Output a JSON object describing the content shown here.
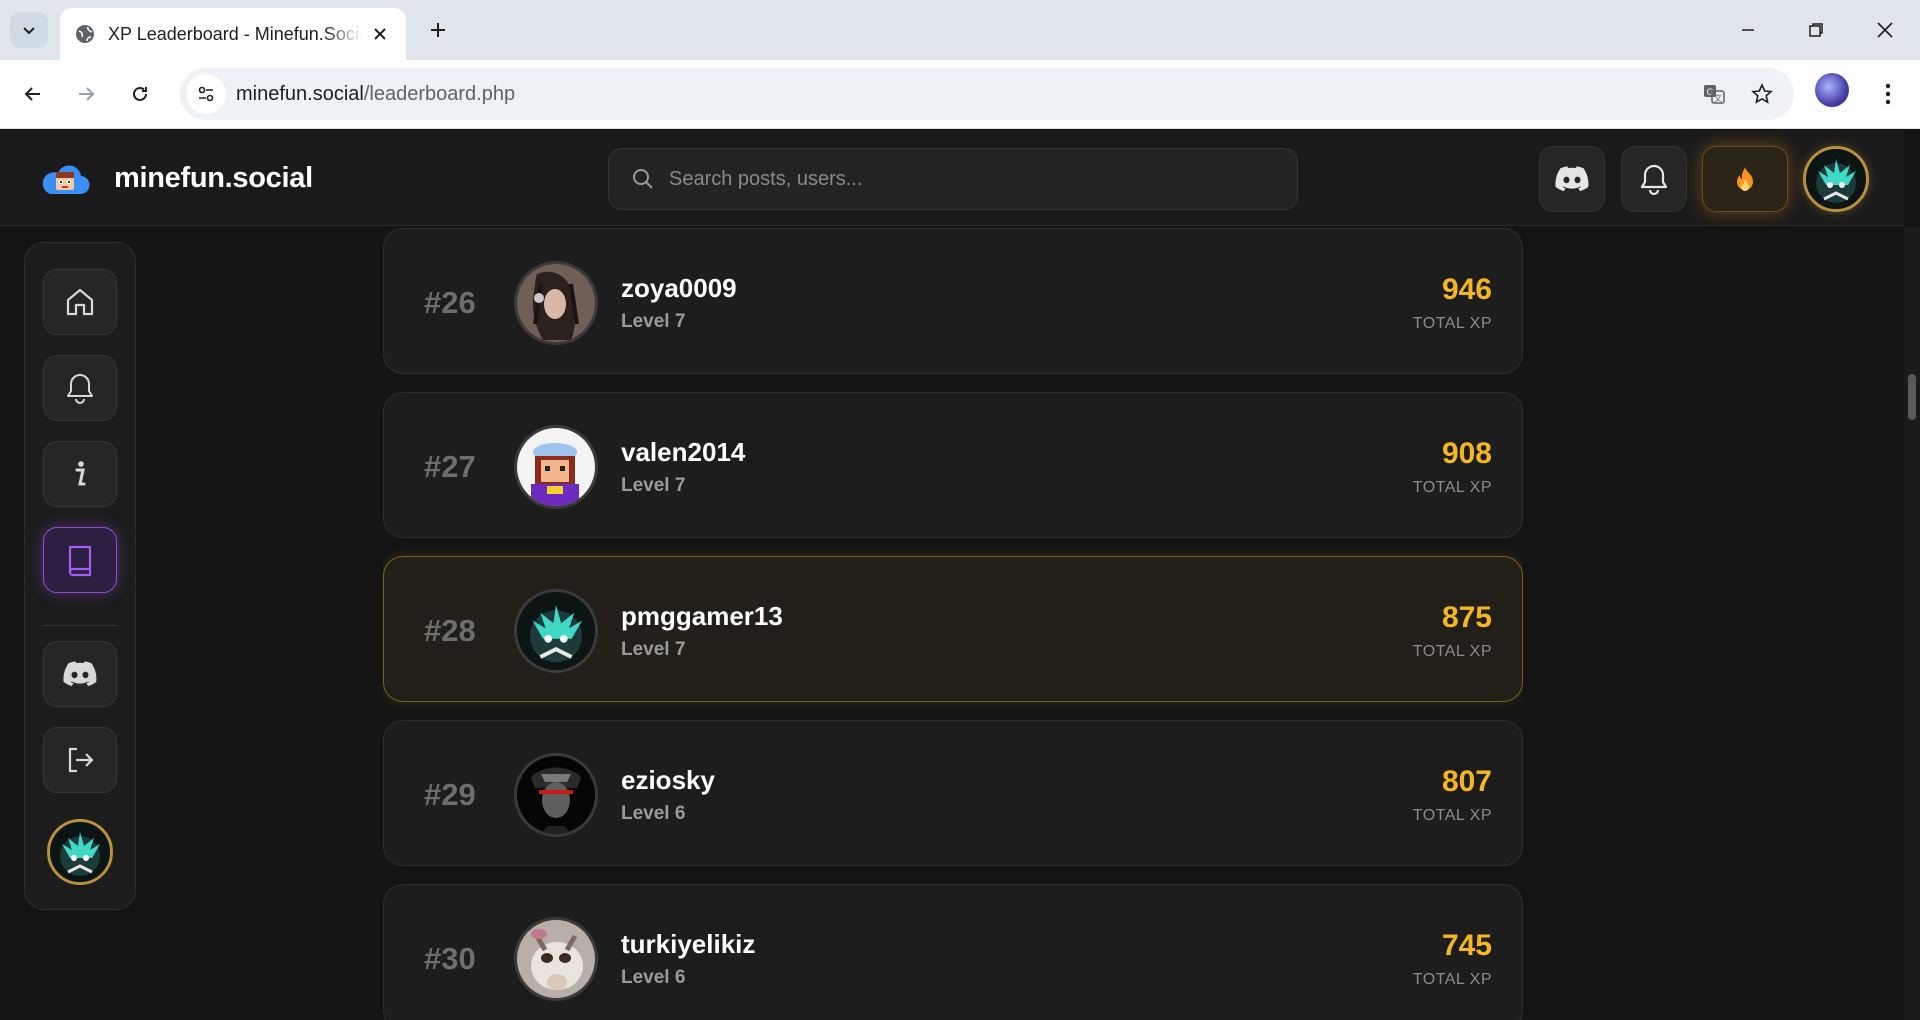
{
  "browser": {
    "tab_title": "XP Leaderboard - Minefun.Social",
    "url_host": "minefun.social",
    "url_path": "/leaderboard.php"
  },
  "site": {
    "logo_text": "minefun.social",
    "search_placeholder": "Search posts, users...",
    "accent_gold": "#f5b623",
    "accent_purple": "#8a4bd8"
  },
  "sidebar": {
    "items": [
      {
        "icon": "home-icon"
      },
      {
        "icon": "bell-icon"
      },
      {
        "icon": "info-icon"
      },
      {
        "icon": "book-icon",
        "active": true
      },
      {
        "icon": "discord-icon"
      },
      {
        "icon": "logout-icon"
      }
    ]
  },
  "leaderboard": {
    "xp_label": "TOTAL XP",
    "entries": [
      {
        "rank": "#26",
        "username": "zoya0009",
        "level": "Level 7",
        "xp": "946"
      },
      {
        "rank": "#27",
        "username": "valen2014",
        "level": "Level 7",
        "xp": "908"
      },
      {
        "rank": "#28",
        "username": "pmggamer13",
        "level": "Level 7",
        "xp": "875",
        "current_user": true
      },
      {
        "rank": "#29",
        "username": "eziosky",
        "level": "Level 6",
        "xp": "807"
      },
      {
        "rank": "#30",
        "username": "turkiyelikiz",
        "level": "Level 6",
        "xp": "745"
      }
    ]
  }
}
